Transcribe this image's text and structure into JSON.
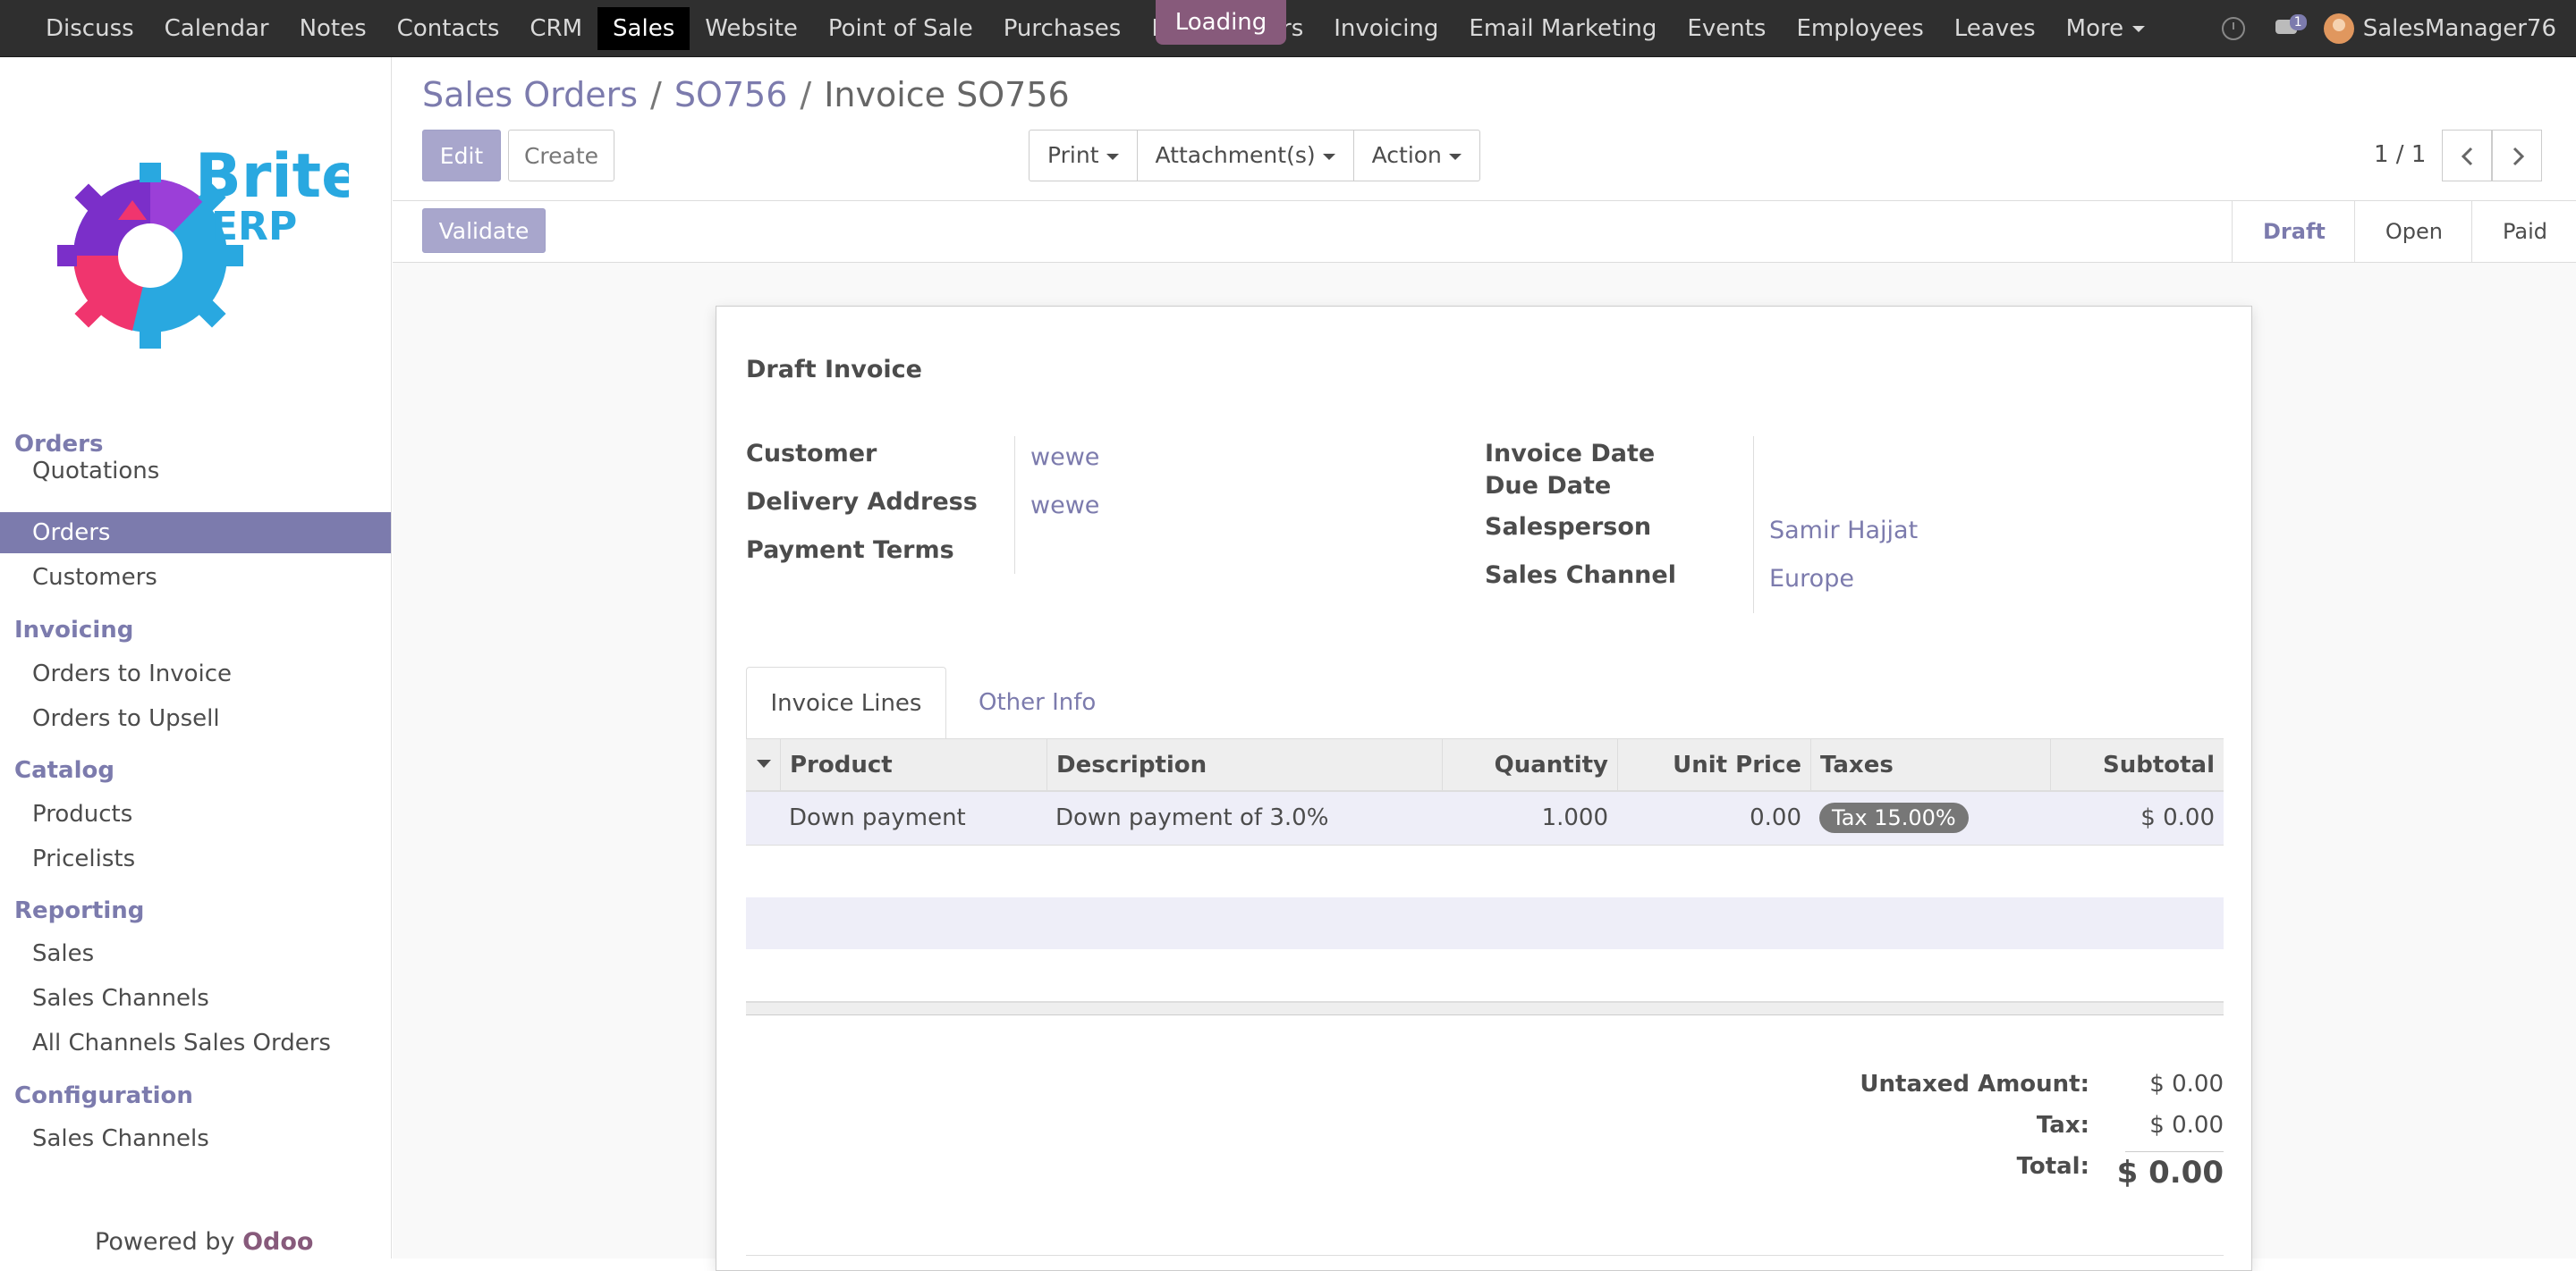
{
  "topbar": {
    "apps": [
      "Discuss",
      "Calendar",
      "Notes",
      "Contacts",
      "CRM",
      "Sales",
      "Website",
      "Point of Sale",
      "Purchases",
      "Inven",
      "pairs",
      "Invoicing",
      "Email Marketing",
      "Events",
      "Employees",
      "Leaves",
      "More"
    ],
    "active_app": "Sales",
    "loading_label": "Loading",
    "messages_count": "1",
    "username": "SalesManager76"
  },
  "sidebar": {
    "logo_text": {
      "brand": "Brite",
      "sub": "ERP"
    },
    "sections": [
      {
        "title": "Orders",
        "items": [
          "Quotations",
          "Orders",
          "Customers"
        ]
      },
      {
        "title": "Invoicing",
        "items": [
          "Orders to Invoice",
          "Orders to Upsell"
        ]
      },
      {
        "title": "Catalog",
        "items": [
          "Products",
          "Pricelists"
        ]
      },
      {
        "title": "Reporting",
        "items": [
          "Sales",
          "Sales Channels",
          "All Channels Sales Orders"
        ]
      },
      {
        "title": "Configuration",
        "items": [
          "Sales Channels"
        ]
      }
    ],
    "active_item": "Orders",
    "powered_by": "Powered by",
    "powered_brand": "Odoo"
  },
  "breadcrumb": {
    "items": [
      "Sales Orders",
      "SO756",
      "Invoice SO756"
    ]
  },
  "buttons": {
    "edit": "Edit",
    "create": "Create",
    "print": "Print",
    "attachments": "Attachment(s)",
    "action": "Action",
    "validate": "Validate"
  },
  "pager": {
    "value": "1 / 1"
  },
  "status_steps": [
    "Draft",
    "Open",
    "Paid"
  ],
  "current_step": "Draft",
  "invoice": {
    "title": "Draft Invoice",
    "left_fields": [
      {
        "label": "Customer",
        "value": "wewe"
      },
      {
        "label": "Delivery Address",
        "value": "wewe"
      },
      {
        "label": "Payment Terms",
        "value": ""
      }
    ],
    "right_fields": [
      {
        "label": "Invoice Date",
        "value": ""
      },
      {
        "label": "Due Date",
        "value": ""
      },
      {
        "label": "Salesperson",
        "value": "Samir Hajjat"
      },
      {
        "label": "Sales Channel",
        "value": "Europe"
      }
    ],
    "tabs": [
      "Invoice Lines",
      "Other Info"
    ],
    "columns": [
      "Product",
      "Description",
      "Quantity",
      "Unit Price",
      "Taxes",
      "Subtotal"
    ],
    "lines": [
      {
        "product": "Down payment",
        "description": "Down payment of 3.0%",
        "quantity": "1.000",
        "unit_price": "0.00",
        "taxes": "Tax 15.00%",
        "subtotal": "$ 0.00"
      }
    ],
    "totals": {
      "untaxed_label": "Untaxed Amount:",
      "untaxed": "$ 0.00",
      "tax_label": "Tax:",
      "tax": "$ 0.00",
      "total_label": "Total:",
      "total": "$ 0.00"
    }
  },
  "colors": {
    "accent": "#7c7bad",
    "brand": "#875a7b",
    "topbar": "#2f2f2f"
  }
}
